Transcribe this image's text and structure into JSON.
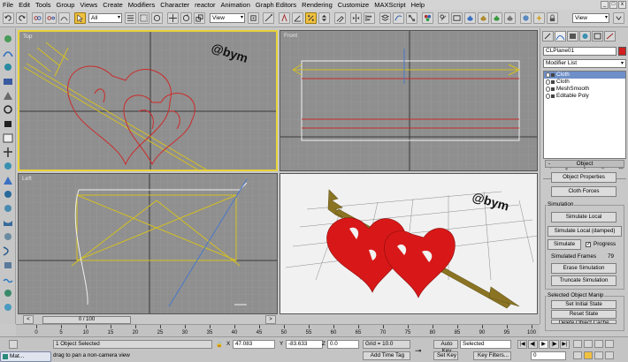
{
  "menu": [
    "File",
    "Edit",
    "Tools",
    "Group",
    "Views",
    "Create",
    "Modifiers",
    "Character",
    "reactor",
    "Animation",
    "Graph Editors",
    "Rendering",
    "Customize",
    "MAXScript",
    "Help"
  ],
  "window_controls": [
    "_",
    "□",
    "x"
  ],
  "toolbar": {
    "selection_filter": "All",
    "ref_coord": "View",
    "named_selection": "View"
  },
  "viewports": {
    "top": {
      "label": "Top",
      "watermark": "@bym"
    },
    "front": {
      "label": "Front"
    },
    "left": {
      "label": "Left"
    },
    "perspective": {
      "label": "",
      "watermark": "@bym"
    }
  },
  "command_panel": {
    "object_name": "CLPlane01",
    "object_color": "#d02020",
    "modifier_list": "Modifier List",
    "stack": [
      {
        "label": "Cloth",
        "highlighted": true
      },
      {
        "label": "Cloth",
        "highlighted": false
      },
      {
        "label": "MeshSmooth",
        "highlighted": false
      },
      {
        "label": "Editable Poly",
        "highlighted": false
      }
    ],
    "rollout_title": "Object",
    "object_properties": "Object Properties",
    "cloth_forces": "Cloth Forces",
    "simulation_group": "Simulation",
    "simulate_local": "Simulate Local",
    "simulate_local_damped": "Simulate Local (damped)",
    "simulate": "Simulate",
    "progress_label": "Progress",
    "progress_checked": "✓",
    "simulated_frames_label": "Simulated Frames",
    "simulated_frames_value": "79",
    "erase_simulation": "Erase Simulation",
    "truncate_simulation": "Truncate Simulation",
    "selected_group": "Selected Object Manip",
    "set_initial_state": "Set Initial State",
    "reset_state": "Reset State",
    "delete_object_cache": "Delete Object Cache"
  },
  "timeline": {
    "slider": "0 / 100",
    "ticks": [
      0,
      5,
      10,
      15,
      20,
      25,
      30,
      35,
      40,
      45,
      50,
      55,
      60,
      65,
      70,
      75,
      80,
      85,
      90,
      95,
      100
    ]
  },
  "status": {
    "selected_count": "1 Object Selected",
    "prompt": "drag to pan a non-camera view",
    "x_label": "X",
    "x_value": "47.083",
    "y_label": "Y",
    "y_value": "-83.633",
    "z_label": "Z",
    "z_value": "0.0",
    "grid": "Grid = 10.0",
    "add_time_tag": "Add Time Tag",
    "auto_key": "Auto Key",
    "key_mode": "Selected",
    "set_key": "Set Key",
    "key_filters": "Key Filters...",
    "frame_field": "0"
  },
  "taskbar": {
    "label": "Mat..."
  }
}
